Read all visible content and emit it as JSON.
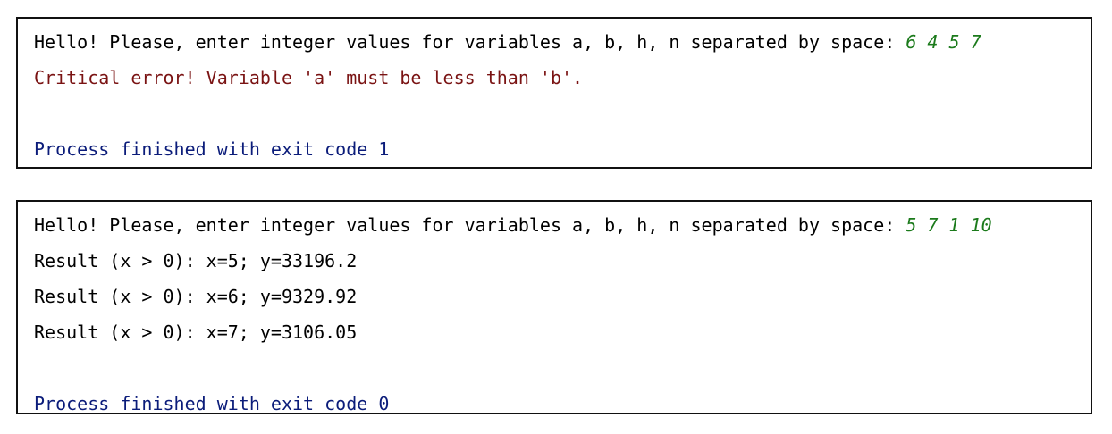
{
  "consoles": [
    {
      "prompt": "Hello! Please, enter integer values for variables a, b, h, n separated by space: ",
      "input": "6 4 5 7",
      "error": "Critical error! Variable 'a' must be less than 'b'.",
      "exit": "Process finished with exit code 1"
    },
    {
      "prompt": "Hello! Please, enter integer values for variables a, b, h, n separated by space: ",
      "input": "5 7 1 10",
      "results": [
        "Result (x > 0): x=5; y=33196.2",
        "Result (x > 0): x=6; y=9329.92",
        "Result (x > 0): x=7; y=3106.05"
      ],
      "exit": "Process finished with exit code 0"
    }
  ],
  "colors": {
    "input": "#1b7a1b",
    "error": "#7a1313",
    "exit": "#0b1c7a"
  }
}
